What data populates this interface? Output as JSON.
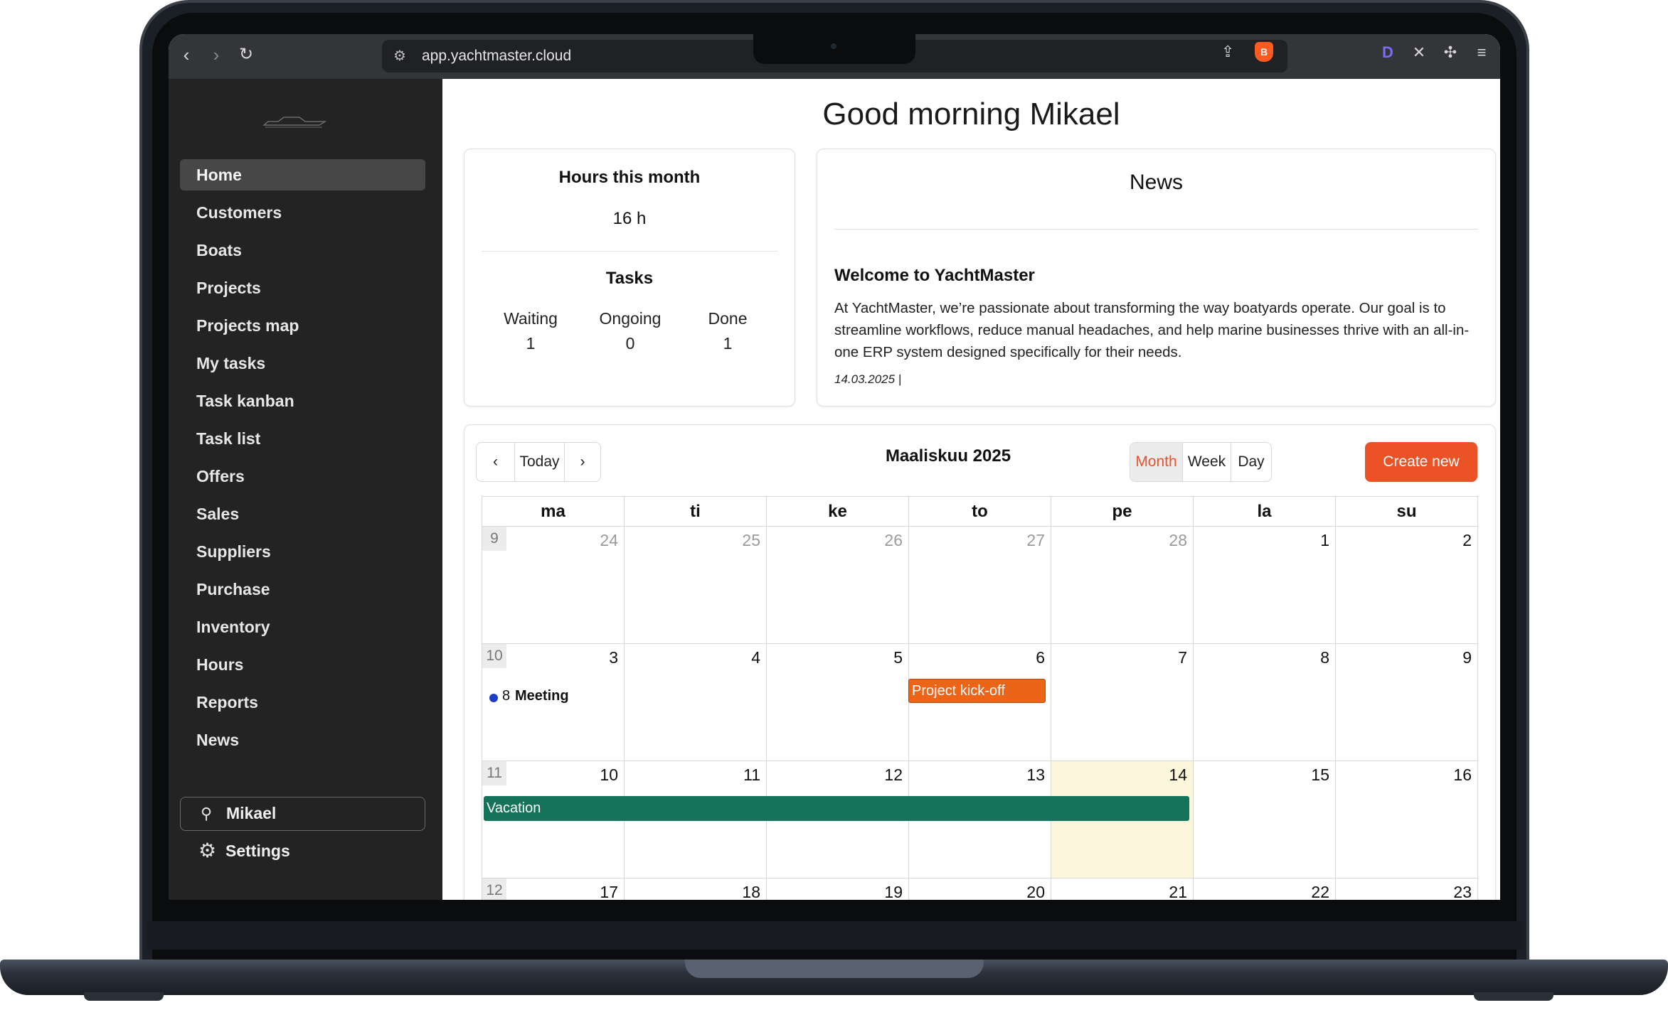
{
  "browser": {
    "url": "app.yachtmaster.cloud"
  },
  "sidebar": {
    "items": [
      {
        "label": "Home"
      },
      {
        "label": "Customers"
      },
      {
        "label": "Boats"
      },
      {
        "label": "Projects"
      },
      {
        "label": "Projects map"
      },
      {
        "label": "My tasks"
      },
      {
        "label": "Task kanban"
      },
      {
        "label": "Task list"
      },
      {
        "label": "Offers"
      },
      {
        "label": "Sales"
      },
      {
        "label": "Suppliers"
      },
      {
        "label": "Purchase"
      },
      {
        "label": "Inventory"
      },
      {
        "label": "Hours"
      },
      {
        "label": "Reports"
      },
      {
        "label": "News"
      }
    ],
    "active": "Home",
    "user": "Mikael",
    "settings": "Settings"
  },
  "main": {
    "greeting": "Good morning Mikael",
    "stats": {
      "hours_title": "Hours this month",
      "hours_value": "16 h",
      "tasks_title": "Tasks",
      "waiting_label": "Waiting",
      "waiting_value": "1",
      "ongoing_label": "Ongoing",
      "ongoing_value": "0",
      "done_label": "Done",
      "done_value": "1"
    },
    "news": {
      "title": "News",
      "headline": "Welcome to YachtMaster",
      "body": "At YachtMaster, we’re passionate about transforming the way boatyards operate. Our goal is to streamline workflows, reduce manual headaches, and help marine businesses thrive with an all-in-one ERP system designed specifically for their needs.",
      "date": "14.03.2025 |"
    },
    "calendar": {
      "title": "Maaliskuu 2025",
      "today_label": "Today",
      "views": [
        "Month",
        "Week",
        "Day"
      ],
      "selected_view": "Month",
      "create_label": "Create new",
      "weekdays": [
        "ma",
        "ti",
        "ke",
        "to",
        "pe",
        "la",
        "su"
      ],
      "weeks": [
        {
          "week": "9",
          "days": [
            "24",
            "25",
            "26",
            "27",
            "28",
            "1",
            "2"
          ],
          "other_month": [
            true,
            true,
            true,
            true,
            true,
            false,
            false
          ]
        },
        {
          "week": "10",
          "days": [
            "3",
            "4",
            "5",
            "6",
            "7",
            "8",
            "9"
          ],
          "other_month": [
            false,
            false,
            false,
            false,
            false,
            false,
            false
          ]
        },
        {
          "week": "11",
          "days": [
            "10",
            "11",
            "12",
            "13",
            "14",
            "15",
            "16"
          ],
          "other_month": [
            false,
            false,
            false,
            false,
            false,
            false,
            false
          ]
        },
        {
          "week": "12",
          "days": [
            "17",
            "18",
            "19",
            "20",
            "21",
            "22",
            "23"
          ],
          "other_month": [
            false,
            false,
            false,
            false,
            false,
            false,
            false
          ]
        }
      ],
      "today": "14",
      "events": {
        "meeting_time": "8",
        "meeting_title": "Meeting",
        "kickoff": "Project kick-off",
        "vacation": "Vacation"
      },
      "colors": {
        "accent": "#eb5327",
        "meeting_dot": "#1c3fc6",
        "kickoff": "#ec6418",
        "vacation": "#15735a",
        "today_bg": "#fbf6dc"
      }
    }
  }
}
